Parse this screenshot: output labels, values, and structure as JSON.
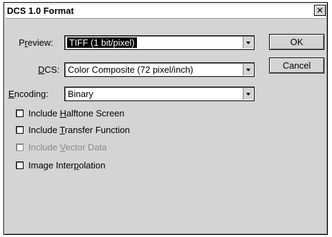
{
  "title": "DCS 1.0 Format",
  "close_glyph": "✕",
  "preview": {
    "label_pre": "P",
    "label_ul": "r",
    "label_post": "eview:",
    "value": "TIFF  (1 bit/pixel)"
  },
  "dcs": {
    "label_ul": "D",
    "label_post": "CS:",
    "value": "Color Composite (72 pixel/inch)"
  },
  "encoding": {
    "label_ul": "E",
    "label_post": "ncoding:",
    "value": "Binary"
  },
  "buttons": {
    "ok": "OK",
    "cancel": "Cancel"
  },
  "checkboxes": [
    {
      "pre": "Include ",
      "ul": "H",
      "post": "alftone Screen",
      "checked": false,
      "enabled": true
    },
    {
      "pre": "Include ",
      "ul": "T",
      "post": "ransfer Function",
      "checked": false,
      "enabled": true
    },
    {
      "pre": "Include ",
      "ul": "V",
      "post": "ector Data",
      "checked": false,
      "enabled": false
    },
    {
      "pre": "Image Inter",
      "ul": "p",
      "post": "olation",
      "checked": false,
      "enabled": true
    }
  ]
}
